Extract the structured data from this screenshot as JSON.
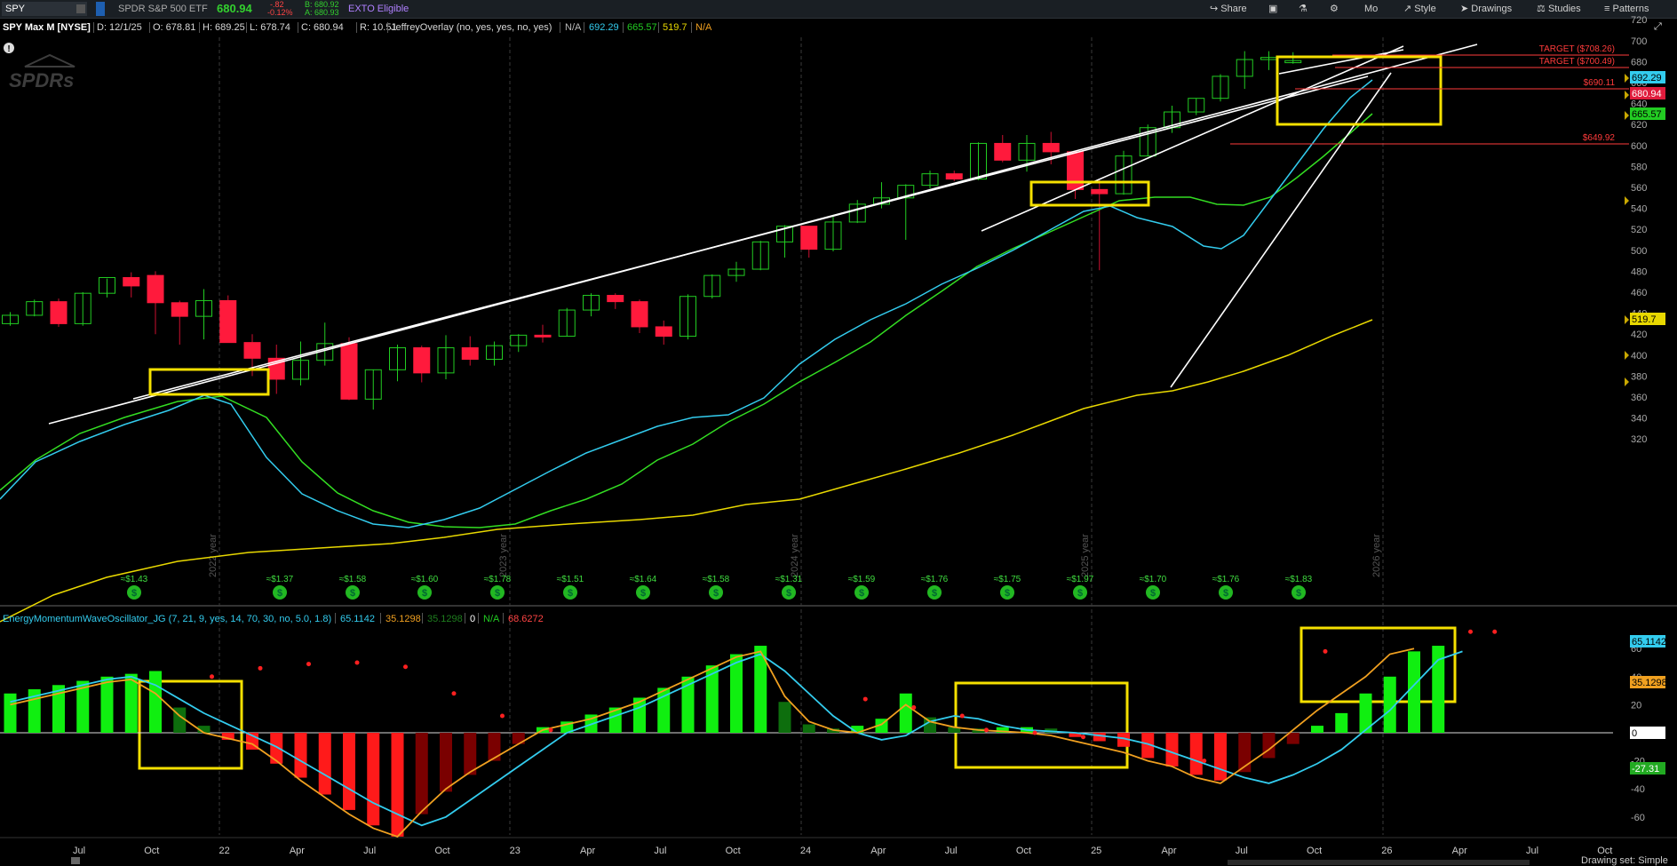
{
  "toolbar": {
    "symbol": "SPY",
    "description": "SPDR S&P 500 ETF",
    "last": "680.94",
    "change": "-.82",
    "change_pct": "-0.12%",
    "bid": "B: 680.92",
    "ask": "A: 680.93",
    "exto": "EXTO Eligible",
    "buttons": [
      "Share",
      "Mo",
      "Style",
      "Drawings",
      "Studies",
      "Patterns"
    ]
  },
  "info": {
    "title": "SPY Max M [NYSE]",
    "date": "D: 12/1/25",
    "open": "O: 678.81",
    "high": "H: 689.25",
    "low": "L: 678.74",
    "close": "C: 680.94",
    "range": "R: 10.51",
    "overlay": "JeffreyOverlay (no, yes, yes, no, yes)",
    "ov_vals": [
      "N/A",
      "692.29",
      "665.57",
      "519.7",
      "N/A"
    ]
  },
  "price_axis": {
    "ticks": [
      "720",
      "700",
      "680",
      "660",
      "640",
      "620",
      "600",
      "580",
      "560",
      "540",
      "520",
      "500",
      "480",
      "460",
      "440",
      "420",
      "400",
      "380",
      "360",
      "340",
      "320"
    ],
    "badges": [
      {
        "label": "692.29",
        "color": "#33ccee"
      },
      {
        "label": "680.94",
        "color": "#e01b3c"
      },
      {
        "label": "665.57",
        "color": "#22cc22"
      },
      {
        "label": "519.7",
        "color": "#e8d800"
      }
    ]
  },
  "price_lines": [
    {
      "label": "TARGET  ($708.26)",
      "color": "#ff3b3b"
    },
    {
      "label": "TARGET  ($700.49)",
      "color": "#ff3b3b"
    },
    {
      "label": "$690.11",
      "color": "#ff3b3b"
    },
    {
      "label": "$649.92",
      "color": "#ff3b3b"
    }
  ],
  "dividends": [
    "≈$1.43",
    "≈$1.37",
    "≈$1.58",
    "≈$1.60",
    "≈$1.78",
    "≈$1.51",
    "≈$1.64",
    "≈$1.58",
    "≈$1.31",
    "≈$1.59",
    "≈$1.76",
    "≈$1.75",
    "≈$1.97",
    "≈$1.70",
    "≈$1.76",
    "≈$1.83"
  ],
  "year_markers": [
    "2022 year",
    "2023 year",
    "2024 year",
    "2025 year",
    "2026 year"
  ],
  "oscillator": {
    "name": "EnergyMomentumWaveOscillator_JG (7, 21, 9, yes, 14, 70, 30, no, 5.0, 1.8)",
    "values": [
      "65.1142",
      "35.1298",
      "35.1298",
      "0",
      "N/A",
      "68.6272"
    ],
    "axis": [
      "60",
      "40",
      "20",
      "0",
      "-20",
      "-40",
      "-60"
    ],
    "badges": [
      {
        "label": "65.1142",
        "color": "#33ccee"
      },
      {
        "label": "35.1298",
        "color": "#f0a020"
      },
      {
        "label": "0",
        "color": "#ffffff"
      },
      {
        "label": "-27.31",
        "color": "#22aa22"
      }
    ]
  },
  "time_axis": [
    "Jul",
    "Oct",
    "22",
    "Apr",
    "Jul",
    "Oct",
    "23",
    "Apr",
    "Jul",
    "Oct",
    "24",
    "Apr",
    "Jul",
    "Oct",
    "25",
    "Apr",
    "Jul",
    "Oct",
    "26",
    "Apr",
    "Jul",
    "Oct"
  ],
  "status": {
    "drawing_set": "Drawing set: Simple"
  }
}
